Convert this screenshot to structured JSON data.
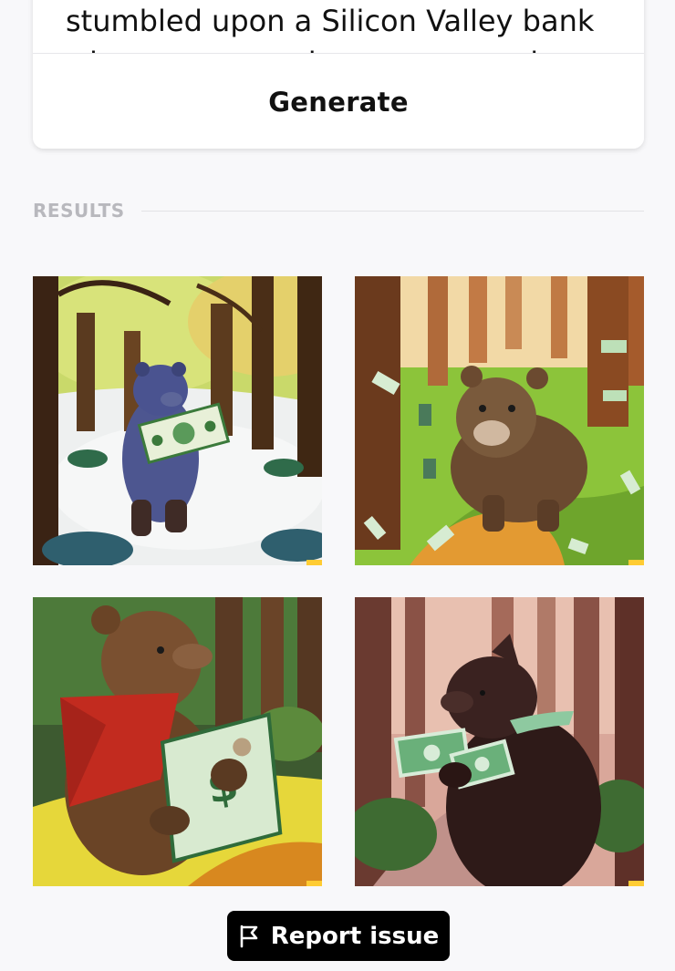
{
  "prompt": {
    "text": "stumbled upon a Silicon Valley bank who was once a bear, now running through a forest"
  },
  "generate": {
    "label": "Generate"
  },
  "results": {
    "label": "RESULTS",
    "images": [
      {
        "icon": "blue-bear-holding-dollar-in-snowy-forest-image"
      },
      {
        "icon": "brown-bear-walking-with-flying-money-image"
      },
      {
        "icon": "bear-in-red-cape-holding-dollar-image"
      },
      {
        "icon": "dark-bear-holding-dollars-in-pink-forest-image"
      }
    ]
  },
  "report": {
    "label": "Report issue",
    "icon": "flag-icon"
  },
  "colors": {
    "background": "#f8f8fa",
    "button_bg": "#000000",
    "results_label": "#b8b8bd"
  }
}
